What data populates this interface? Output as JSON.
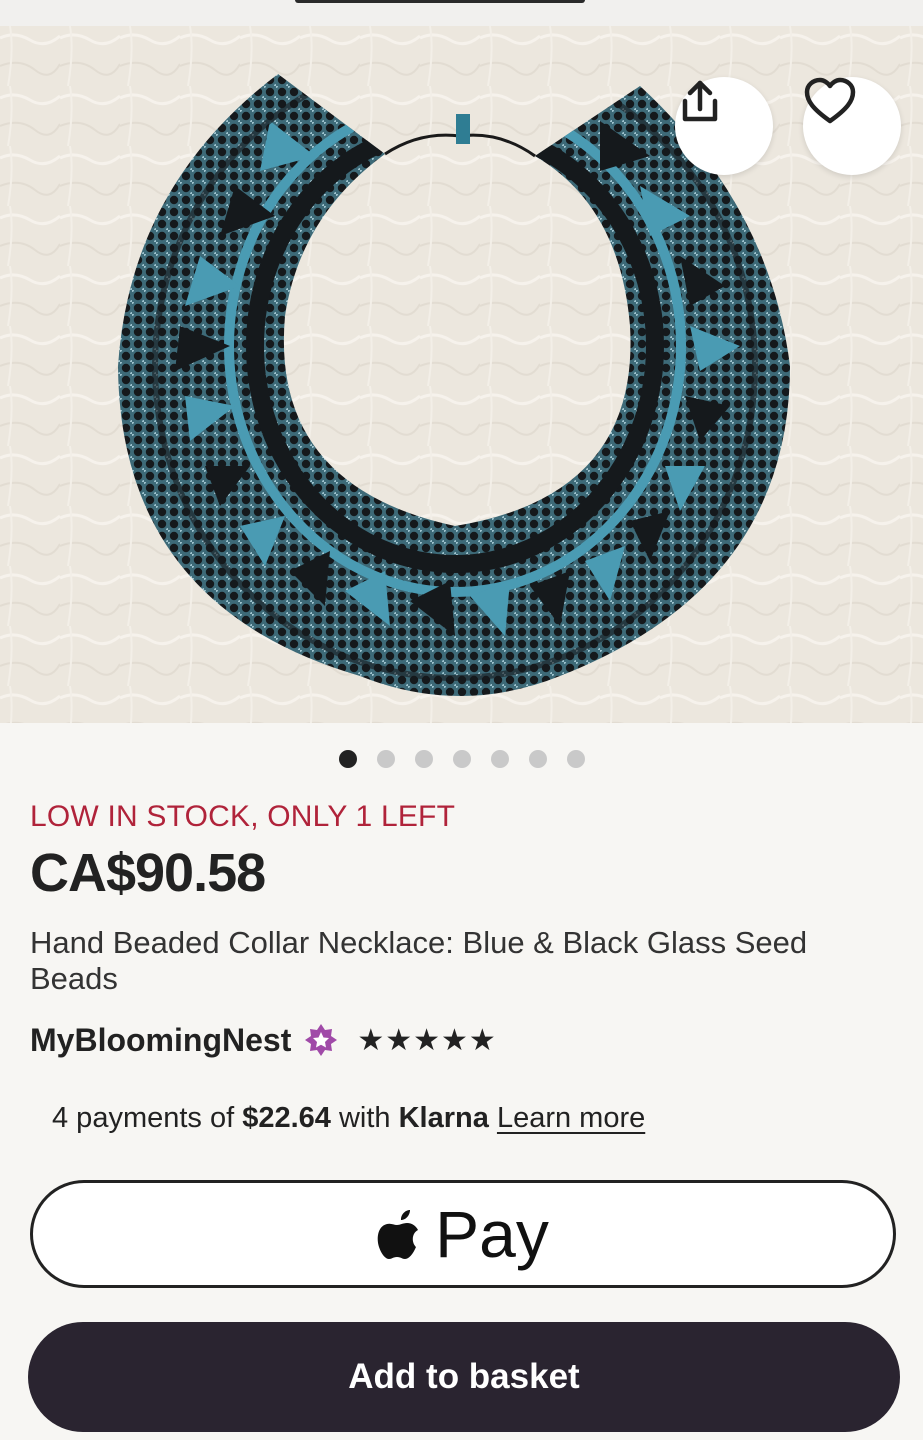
{
  "listing": {
    "stock_notice": "LOW IN STOCK, ONLY 1 LEFT",
    "price": "CA$90.58",
    "title": "Hand Beaded Collar Necklace: Blue & Black Glass Seed Beads",
    "seller": "MyBloomingNest",
    "rating_stars": "★★★★★",
    "rating_value": 5
  },
  "gallery": {
    "image_count": 7,
    "active_index": 0,
    "share_icon": "share-icon",
    "favorite_icon": "heart-icon"
  },
  "payment": {
    "prefix": "4 payments of ",
    "amount": "$22.64",
    "mid": " with ",
    "provider": "Klarna",
    "learn_more": "Learn more"
  },
  "actions": {
    "apple_pay_label": "Pay",
    "add_to_basket": "Add to basket"
  },
  "colors": {
    "stock_red": "#b0233a",
    "button_dark": "#2a2430",
    "bead_blue": "#4a9bb3",
    "bead_black": "#15191c"
  }
}
